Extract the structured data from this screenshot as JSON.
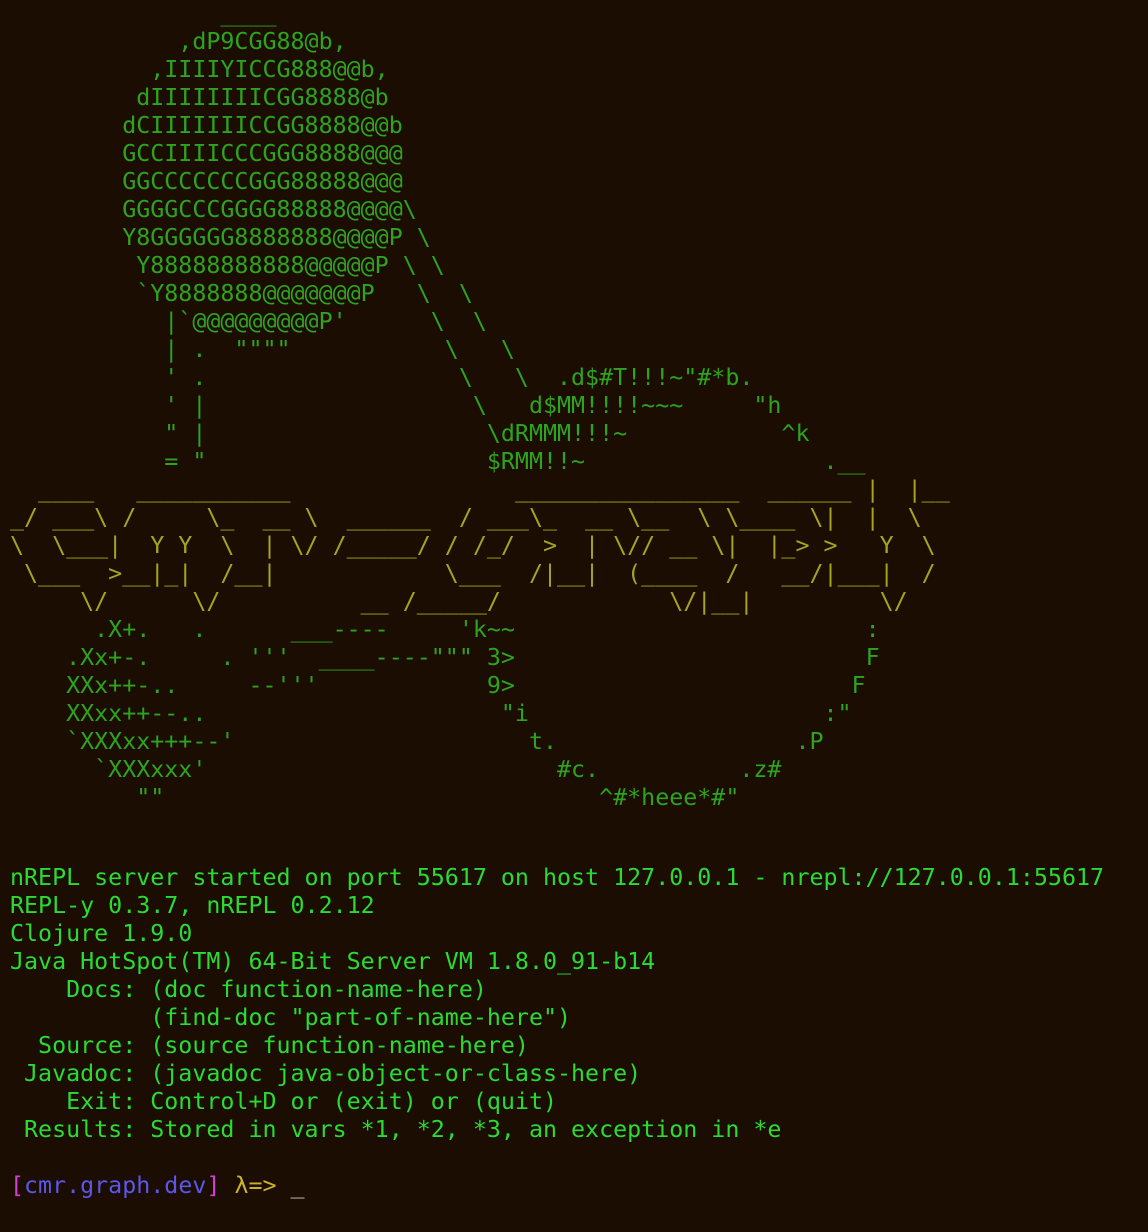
{
  "colors": {
    "background": "#1b0d02",
    "logo_green": "#2ea31e",
    "logo_olive": "#a7a51e",
    "output_green": "#2adb34",
    "prompt_bracket": "#d43fd4",
    "prompt_namespace": "#5b57e8",
    "prompt_lambda": "#c9b52a"
  },
  "banner": {
    "art_top": "               ____\n            ,dP9CGG88@b,\n          ,IIIIYICCG888@@b,\n         dIIIIIIIICGG8888@b\n        dCIIIIIIICCGG8888@@b\n        GCCIIIICCCGGG8888@@@\n        GGCCCCCCCGGG88888@@@\n        GGGGCCCGGGG88888@@@@\\\n        Y8GGGGGG8888888@@@@P \\\n         Y88888888888@@@@@P \\ \\\n         `Y8888888@@@@@@@P   \\  \\\n           |`@@@@@@@@@P'      \\  \\\n           | .  \"\"\"\"           \\   \\\n           ' .                  \\   \\  .d$#T!!!~\"#*b.\n           ' |                   \\   d$MM!!!!~~~     \"h\n           \" |                    \\dRMMM!!!~           ^k\n           = \"                    $RMM!!~                 .__",
    "art_logo": "  ____   ___________                ________________  ______ |  |__\n_/ ___\\ /     \\_  __ \\  ______  / ___\\_  __ \\__  \\ \\____ \\|  |  \\\n\\  \\___|  Y Y  \\  | \\/ /_____/ / /_/  >  | \\// __ \\|  |_> >   Y  \\\n \\___  >__|_|  /__|            \\___  /|__|  (____  /   __/|___|  /\n     \\/      \\/          __ /_____/            \\/|__|         \\/",
    "art_bottom": "      .X+.   .      ___----     'k~~                         :\n    .Xx+-.     . '''  ____----\"\"\" 3>                         F\n    XXx++-..     --'''            9>                        F\n    XXxx++--..                     \"i                     :\"\n    `XXXxx+++--'                     t.                 .P\n      `XXXxxx'                         #c.          .z#\n         \"\"                               ^#*heee*#\""
  },
  "info_lines": [
    "nREPL server started on port 55617 on host 127.0.0.1 - nrepl://127.0.0.1:55617",
    "REPL-y 0.3.7, nREPL 0.2.12",
    "Clojure 1.9.0",
    "Java HotSpot(TM) 64-Bit Server VM 1.8.0_91-b14",
    "    Docs: (doc function-name-here)",
    "          (find-doc \"part-of-name-here\")",
    "  Source: (source function-name-here)",
    " Javadoc: (javadoc java-object-or-class-here)",
    "    Exit: Control+D or (exit) or (quit)",
    " Results: Stored in vars *1, *2, *3, an exception in *e"
  ],
  "prompt": {
    "open_bracket": "[",
    "namespace": "cmr.graph.dev",
    "close_bracket": "]",
    "symbol": "λ=>",
    "cursor": "_"
  }
}
